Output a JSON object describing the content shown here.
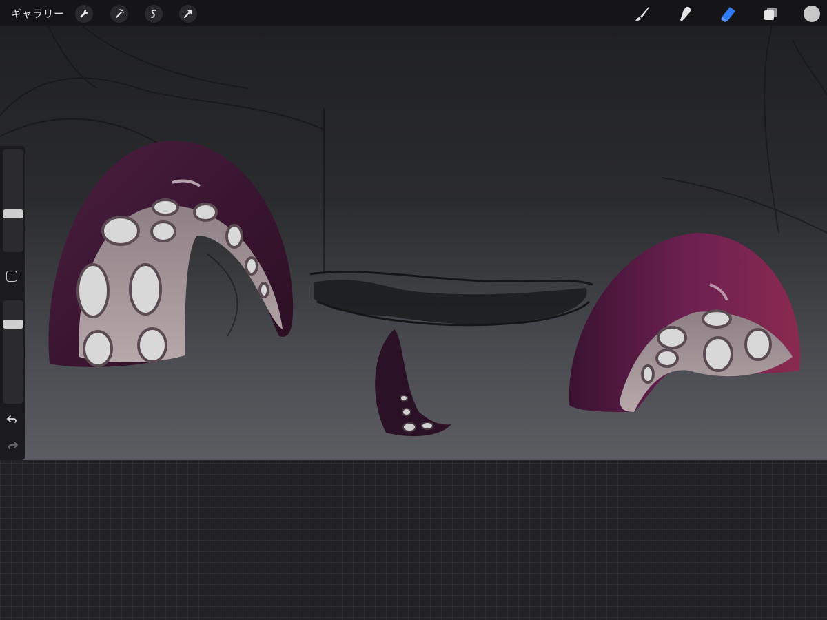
{
  "topbar": {
    "gallery_label": "ギャラリー",
    "left_tools": [
      {
        "name": "actions",
        "icon": "wrench-icon"
      },
      {
        "name": "adjustments",
        "icon": "magic-wand-icon"
      },
      {
        "name": "selection",
        "icon": "selection-s-icon"
      },
      {
        "name": "transform",
        "icon": "arrow-cursor-icon"
      }
    ],
    "right_tools": [
      {
        "name": "brush",
        "icon": "brush-icon",
        "active": false
      },
      {
        "name": "smudge",
        "icon": "smudge-finger-icon",
        "active": false
      },
      {
        "name": "eraser",
        "icon": "eraser-icon",
        "active": true
      },
      {
        "name": "layers",
        "icon": "layers-icon",
        "active": false
      }
    ],
    "active_color": "#c8c8c8",
    "accent_color": "#2f7bf5"
  },
  "sidebar": {
    "brush_size": 0.6,
    "opacity": 0.78,
    "modify_icon": "square-icon",
    "undo_icon": "undo-icon",
    "redo_icon": "redo-icon"
  }
}
